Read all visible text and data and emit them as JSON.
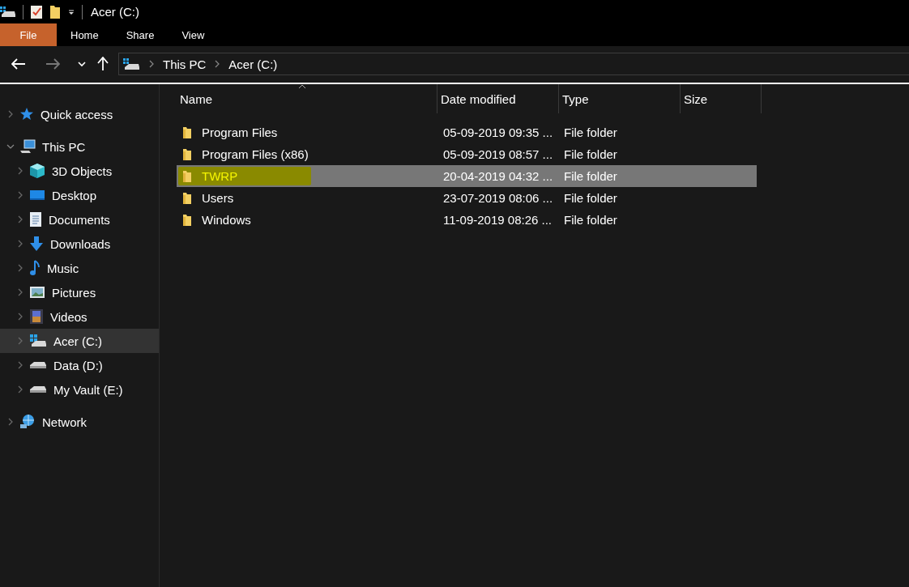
{
  "window": {
    "title": "Acer (C:)"
  },
  "ribbon_tabs": [
    {
      "label": "File",
      "kind": "file"
    },
    {
      "label": "Home",
      "kind": "tab"
    },
    {
      "label": "Share",
      "kind": "tab"
    },
    {
      "label": "View",
      "kind": "tab"
    }
  ],
  "navigation": {
    "back": {
      "disabled": false
    },
    "forward": {
      "disabled": true
    }
  },
  "address_bar": {
    "breadcrumbs": [
      "This PC",
      "Acer (C:)"
    ]
  },
  "sidebar": {
    "items": [
      {
        "label": "Quick access",
        "kind": "star",
        "expanded": false,
        "selected": false
      },
      {
        "label": "This PC",
        "kind": "pc",
        "expanded": true,
        "selected": false,
        "children": [
          {
            "label": "3D Objects",
            "kind": "cube",
            "expanded": false,
            "selected": false
          },
          {
            "label": "Desktop",
            "kind": "desktop",
            "expanded": false,
            "selected": false
          },
          {
            "label": "Documents",
            "kind": "document",
            "expanded": false,
            "selected": false
          },
          {
            "label": "Downloads",
            "kind": "download",
            "expanded": false,
            "selected": false
          },
          {
            "label": "Music",
            "kind": "music",
            "expanded": false,
            "selected": false
          },
          {
            "label": "Pictures",
            "kind": "picture",
            "expanded": false,
            "selected": false
          },
          {
            "label": "Videos",
            "kind": "video",
            "expanded": false,
            "selected": false
          },
          {
            "label": "Acer (C:)",
            "kind": "system-drive",
            "expanded": false,
            "selected": true
          },
          {
            "label": "Data (D:)",
            "kind": "drive",
            "expanded": false,
            "selected": false
          },
          {
            "label": "My Vault (E:)",
            "kind": "drive",
            "expanded": false,
            "selected": false
          }
        ]
      },
      {
        "label": "Network",
        "kind": "network",
        "expanded": false,
        "selected": false
      }
    ]
  },
  "file_list": {
    "columns": [
      "Name",
      "Date modified",
      "Type",
      "Size"
    ],
    "rows": [
      {
        "name": "Program Files",
        "date_modified": "05-09-2019 09:35 ...",
        "type": "File folder",
        "selected": false,
        "highlighted": false
      },
      {
        "name": "Program Files (x86)",
        "date_modified": "05-09-2019 08:57 ...",
        "type": "File folder",
        "selected": false,
        "highlighted": false
      },
      {
        "name": "TWRP",
        "date_modified": "20-04-2019 04:32 ...",
        "type": "File folder",
        "selected": true,
        "highlighted": true
      },
      {
        "name": "Users",
        "date_modified": "23-07-2019 08:06 ...",
        "type": "File folder",
        "selected": false,
        "highlighted": false
      },
      {
        "name": "Windows",
        "date_modified": "11-09-2019 08:26 ...",
        "type": "File folder",
        "selected": false,
        "highlighted": false
      }
    ]
  }
}
